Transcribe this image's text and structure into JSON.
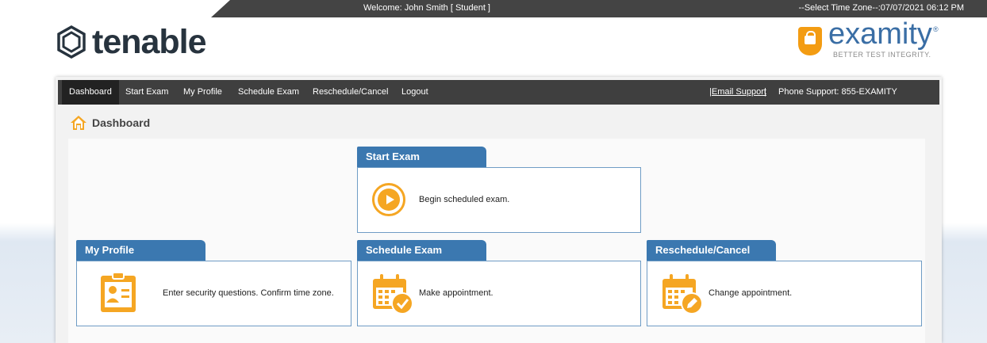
{
  "topbar": {
    "welcome": "Welcome: John Smith   [ Student ]",
    "timezone": "--Select Time Zone--:07/07/2021 06:12 PM"
  },
  "logos": {
    "tenable": "tenable",
    "examity": "examity",
    "examity_reg": "®",
    "examity_tagline": "BETTER TEST INTEGRITY."
  },
  "nav": {
    "items": [
      "Dashboard",
      "Start Exam",
      "My Profile",
      "Schedule Exam",
      "Reschedule/Cancel",
      "Logout"
    ],
    "email_support": "|Email Support",
    "separator": "|",
    "phone_support": "Phone Support: 855-EXAMITY"
  },
  "page": {
    "title": "Dashboard"
  },
  "cards": {
    "start_exam": {
      "title": "Start Exam",
      "description": "Begin scheduled exam."
    },
    "my_profile": {
      "title": "My Profile",
      "description": "Enter security questions. Confirm time zone."
    },
    "schedule_exam": {
      "title": "Schedule Exam",
      "description": "Make appointment."
    },
    "reschedule_cancel": {
      "title": "Reschedule/Cancel",
      "description": "Change appointment."
    }
  },
  "colors": {
    "accent_blue": "#3b78b0",
    "accent_orange": "#f5a623",
    "nav_bg": "#3f3f3f"
  },
  "icons": {
    "home": "home-icon",
    "play": "play-icon",
    "profile": "id-card-icon",
    "calendar_check": "calendar-check-icon",
    "calendar_edit": "calendar-edit-icon"
  }
}
